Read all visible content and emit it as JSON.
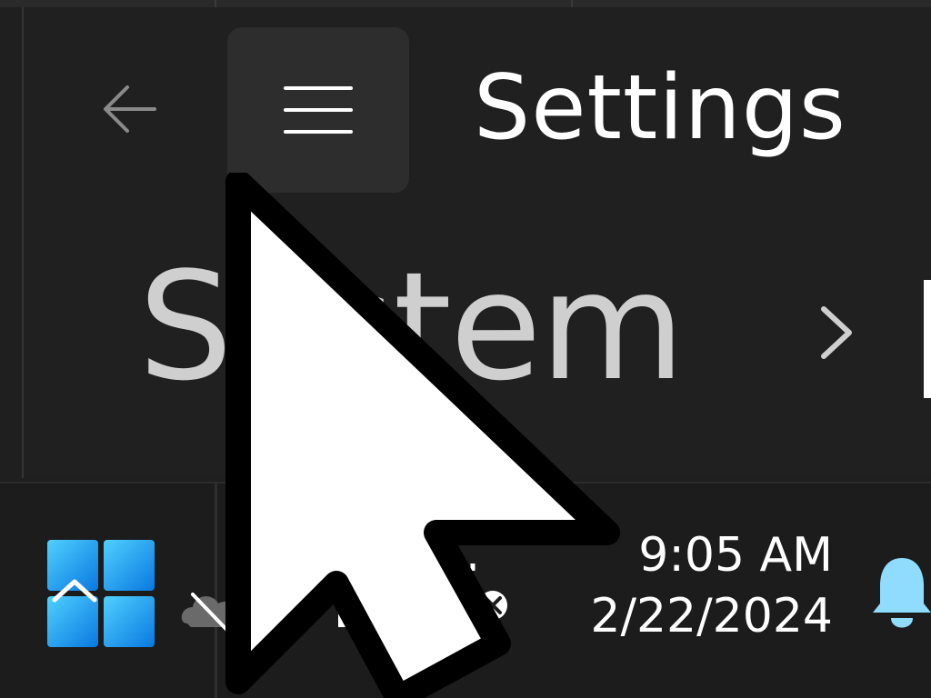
{
  "window": {
    "app_title": "Settings",
    "breadcrumb": [
      "System"
    ]
  },
  "taskbar": {
    "clock_time": "9:05 AM",
    "clock_date": "2/22/2024"
  },
  "icons": {
    "back": "back-arrow-icon",
    "menu": "hamburger-menu-icon",
    "start": "windows-start-icon",
    "chevron_up": "chevron-up-icon",
    "cloud": "onedrive-cloud-icon",
    "bell": "notification-bell-icon",
    "cursor": "mouse-pointer-icon"
  },
  "colors": {
    "background": "#202020",
    "accent_blue": "#1aa3f0",
    "bell_blue": "#8fdcff",
    "text": "#ffffff"
  }
}
